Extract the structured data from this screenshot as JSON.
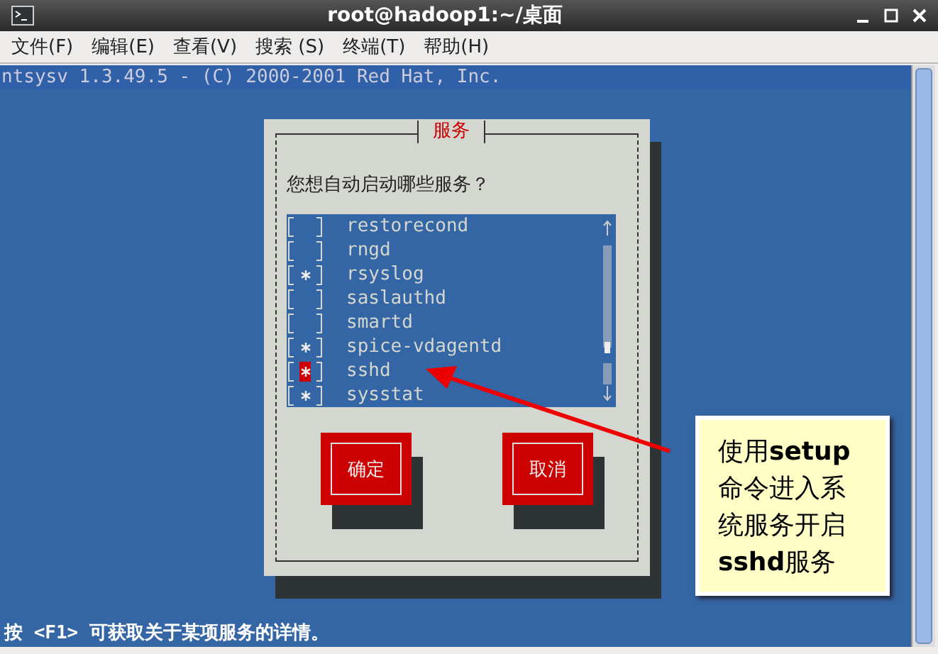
{
  "window": {
    "title": "root@hadoop1:~/桌面"
  },
  "menu": [
    "文件(F)",
    "编辑(E)",
    "查看(V)",
    "搜索 (S)",
    "终端(T)",
    "帮助(H)"
  ],
  "terminal": {
    "header": "ntsysv 1.3.49.5 - (C) 2000-2001 Red Hat, Inc.",
    "footer": "按 <F1> 可获取关于某项服务的详情。"
  },
  "dialog": {
    "title": "服务",
    "prompt": "您想自动启动哪些服务？",
    "services": [
      {
        "name": "restorecond",
        "checked": false,
        "selected": false
      },
      {
        "name": "rngd",
        "checked": false,
        "selected": false
      },
      {
        "name": "rsyslog",
        "checked": true,
        "selected": false
      },
      {
        "name": "saslauthd",
        "checked": false,
        "selected": false
      },
      {
        "name": "smartd",
        "checked": false,
        "selected": false
      },
      {
        "name": "spice-vdagentd",
        "checked": true,
        "selected": false
      },
      {
        "name": "sshd",
        "checked": true,
        "selected": true
      },
      {
        "name": "sysstat",
        "checked": true,
        "selected": false
      }
    ],
    "buttons": [
      "确定",
      "取消"
    ]
  },
  "callout": {
    "text": "使用**setup**命令进入系统服务开启**sshd**服务"
  }
}
